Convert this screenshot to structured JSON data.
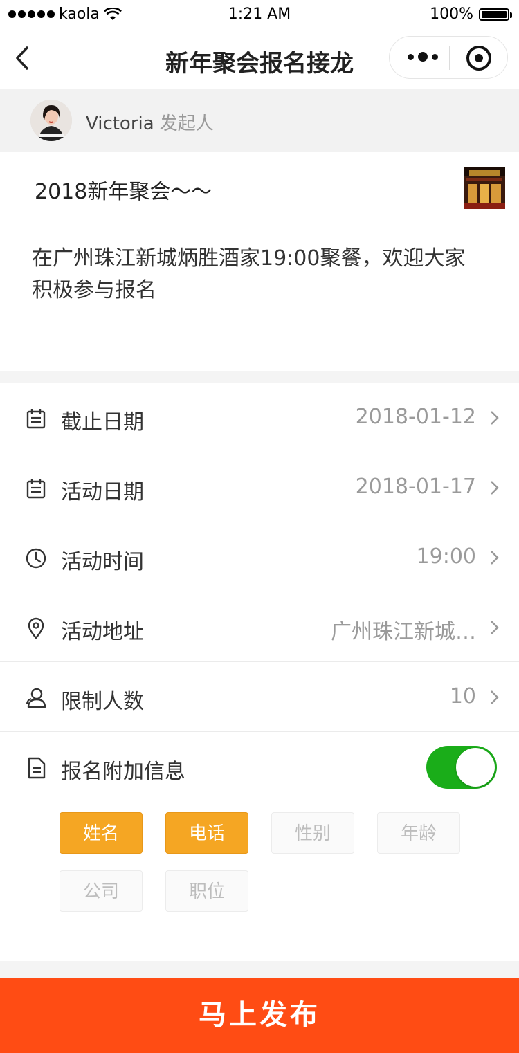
{
  "status_bar": {
    "carrier": "kaola",
    "time": "1:21 AM",
    "battery": "100%"
  },
  "nav": {
    "title": "新年聚会报名接龙"
  },
  "initiator": {
    "name": "Victoria",
    "role": "发起人"
  },
  "event": {
    "title": "2018新年聚会～～",
    "description": "在广州珠江新城炳胜酒家19:00聚餐，欢迎大家积极参与报名"
  },
  "fields": [
    {
      "label": "截止日期",
      "value": "2018-01-12",
      "icon": "calendar-icon"
    },
    {
      "label": "活动日期",
      "value": "2018-01-17",
      "icon": "calendar-icon"
    },
    {
      "label": "活动时间",
      "value": "19:00",
      "icon": "clock-icon"
    },
    {
      "label": "活动地址",
      "value": "广州珠江新城…",
      "icon": "location-pin-icon"
    },
    {
      "label": "限制人数",
      "value": "10",
      "icon": "person-icon"
    }
  ],
  "extra_info": {
    "label": "报名附加信息",
    "enabled": true,
    "tags": [
      {
        "label": "姓名",
        "selected": true
      },
      {
        "label": "电话",
        "selected": true
      },
      {
        "label": "性别",
        "selected": false
      },
      {
        "label": "年龄",
        "selected": false
      },
      {
        "label": "公司",
        "selected": false
      },
      {
        "label": "职位",
        "selected": false
      }
    ]
  },
  "publish_button": "马上发布",
  "colors": {
    "accent": "#f5a623",
    "toggle_on": "#1aad19",
    "publish": "#ff4c14"
  }
}
